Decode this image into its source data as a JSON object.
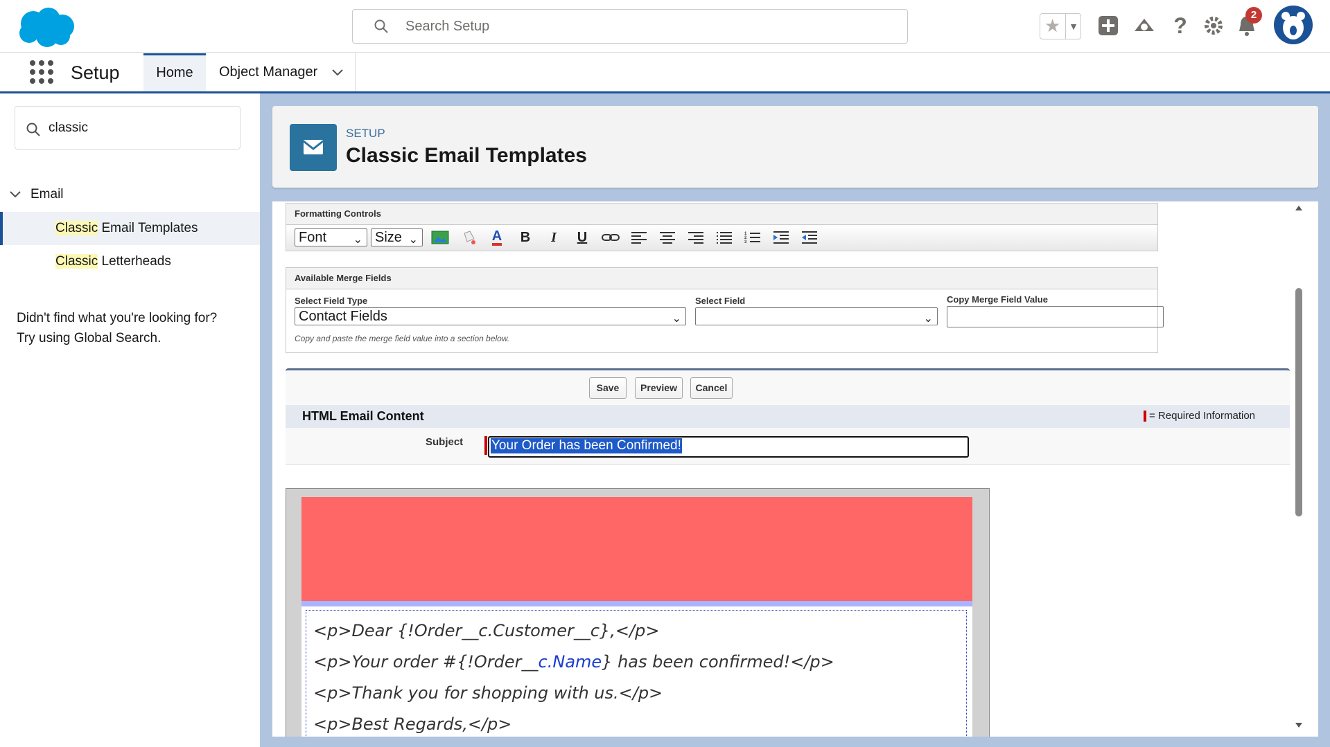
{
  "header": {
    "search_placeholder": "Search Setup",
    "notification_count": "2",
    "icons": [
      "favorites-star-icon",
      "global-actions-add-icon",
      "trailhead-icon",
      "help-icon",
      "setup-gear-icon",
      "notifications-bell-icon"
    ]
  },
  "nav": {
    "app_name": "Setup",
    "tabs": [
      {
        "label": "Home"
      },
      {
        "label": "Object Manager"
      }
    ]
  },
  "sidebar": {
    "quick_find_value": "classic",
    "tree": {
      "group_label": "Email",
      "items": [
        {
          "highlight": "Classic",
          "rest": " Email Templates"
        },
        {
          "highlight": "Classic",
          "rest": " Letterheads"
        }
      ]
    },
    "help_line1": "Didn't find what you're looking for?",
    "help_line2": "Try using Global Search."
  },
  "page_header": {
    "eyebrow": "SETUP",
    "title": "Classic Email Templates"
  },
  "formatting": {
    "title": "Formatting Controls",
    "font_label": "Font",
    "size_label": "Size",
    "tools": [
      "insert-image-icon",
      "background-color-icon",
      "text-color-icon",
      "bold-icon",
      "italic-icon",
      "underline-icon",
      "link-icon",
      "align-left-icon",
      "align-center-icon",
      "align-right-icon",
      "bulleted-list-icon",
      "numbered-list-icon",
      "indent-icon",
      "outdent-icon"
    ],
    "bold": "B",
    "italic": "I",
    "underline": "U",
    "color": "A"
  },
  "merge": {
    "title": "Available Merge Fields",
    "field_type_label": "Select Field Type",
    "field_type_value": "Contact Fields",
    "field_label": "Select Field",
    "field_value": "",
    "copy_label": "Copy Merge Field Value",
    "copy_value": "",
    "hint": "Copy and paste the merge field value into a section below."
  },
  "form": {
    "save": "Save",
    "preview": "Preview",
    "cancel": "Cancel",
    "section_title": "HTML Email Content",
    "required_info": "= Required Information",
    "subject_label": "Subject",
    "subject_value": "Your Order has been Confirmed!"
  },
  "email_body": {
    "header_color": "#ff6666",
    "lines": [
      {
        "pre": "<p>Dear {!Order__c.Customer__c},</p>"
      },
      {
        "pre": "<p>Your order #{!Order__",
        "link": "c.Name",
        "post": "} has been confirmed!</p>"
      },
      {
        "pre": "<p>Thank you for shopping with us.</p>"
      },
      {
        "pre": "<p>Best Regards,</p>"
      }
    ]
  }
}
